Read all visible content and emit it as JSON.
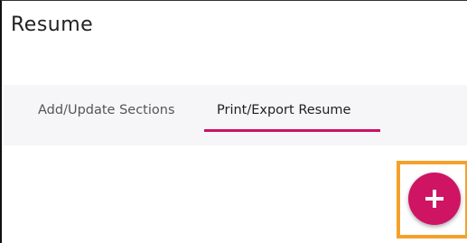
{
  "header": {
    "title": "Resume"
  },
  "tabs": [
    {
      "label": "Add/Update Sections",
      "active": false
    },
    {
      "label": "Print/Export Resume",
      "active": true
    }
  ],
  "fab": {
    "icon": "plus-icon",
    "color": "#cf1464"
  },
  "highlight": {
    "color": "#f5a02a"
  },
  "accent_color": "#cc1166"
}
